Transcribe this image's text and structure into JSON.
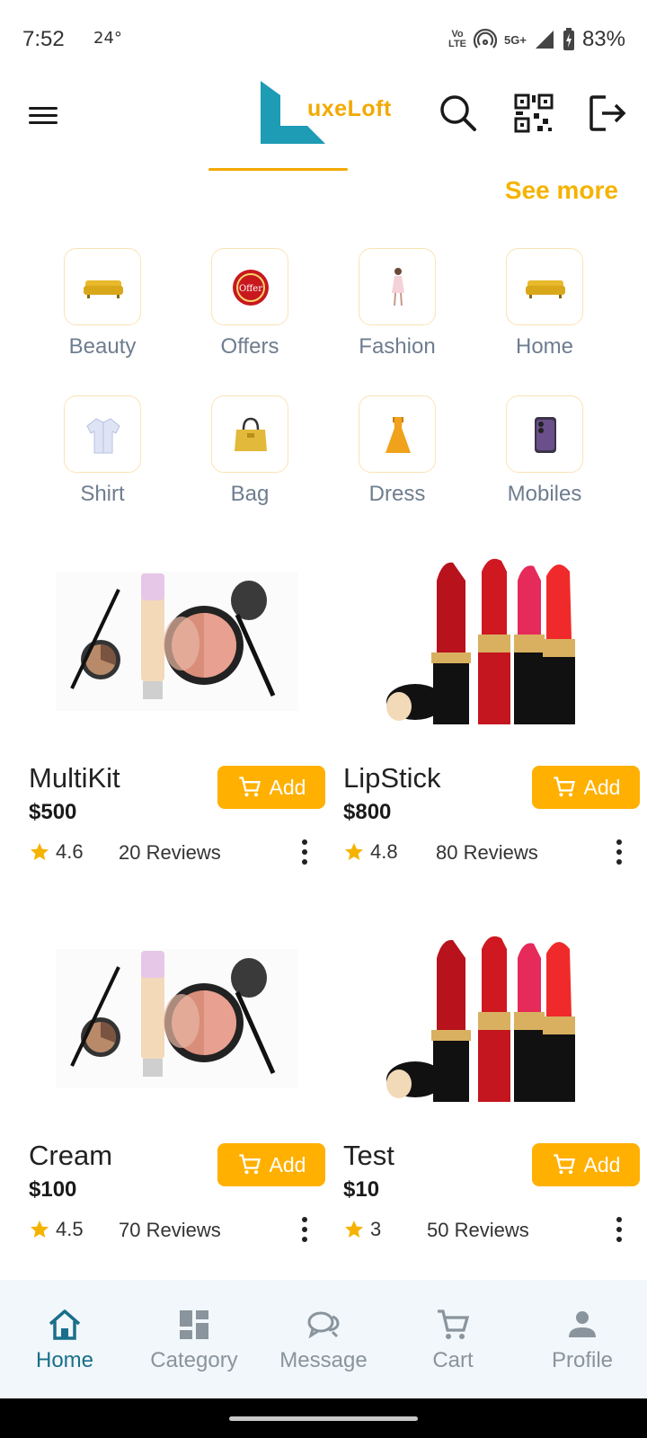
{
  "status_bar": {
    "time": "7:52",
    "temperature": "24°",
    "volte": "Vo\nLTE",
    "network": "5G+",
    "battery": "83%"
  },
  "header": {
    "logo_text": "uxeLoft",
    "icons": [
      "menu-icon",
      "search-icon",
      "qr-code-icon",
      "logout-icon"
    ]
  },
  "see_more": "See more",
  "categories": [
    {
      "label": "Beauty",
      "icon": "sofa-icon"
    },
    {
      "label": "Offers",
      "icon": "offer-badge-icon"
    },
    {
      "label": "Fashion",
      "icon": "model-icon"
    },
    {
      "label": "Home",
      "icon": "sofa-icon"
    },
    {
      "label": "Shirt",
      "icon": "shirt-icon"
    },
    {
      "label": "Bag",
      "icon": "handbag-icon"
    },
    {
      "label": "Dress",
      "icon": "dress-icon"
    },
    {
      "label": "Mobiles",
      "icon": "phone-icon"
    }
  ],
  "products": [
    {
      "name": "MultiKit",
      "price": "$500",
      "rating": "4.6",
      "reviews": "20 Reviews",
      "add_label": "Add",
      "image": "makeup-kit"
    },
    {
      "name": "LipStick",
      "price": "$800",
      "rating": "4.8",
      "reviews": "80 Reviews",
      "add_label": "Add",
      "image": "lipsticks"
    },
    {
      "name": "Cream",
      "price": "$100",
      "rating": "4.5",
      "reviews": "70 Reviews",
      "add_label": "Add",
      "image": "makeup-kit"
    },
    {
      "name": "Test",
      "price": "$10",
      "rating": "3",
      "reviews": "50 Reviews",
      "add_label": "Add",
      "image": "lipsticks"
    }
  ],
  "bottom_nav": [
    {
      "label": "Home",
      "icon": "home-icon",
      "active": true
    },
    {
      "label": "Category",
      "icon": "dashboard-icon",
      "active": false
    },
    {
      "label": "Message",
      "icon": "chat-icon",
      "active": false
    },
    {
      "label": "Cart",
      "icon": "cart-icon",
      "active": false
    },
    {
      "label": "Profile",
      "icon": "person-icon",
      "active": false
    }
  ],
  "colors": {
    "accent": "#ffb000",
    "logo_teal": "#1e9bb5",
    "nav_active": "#1a6f8a",
    "nav_bg": "#f1f7fa"
  }
}
